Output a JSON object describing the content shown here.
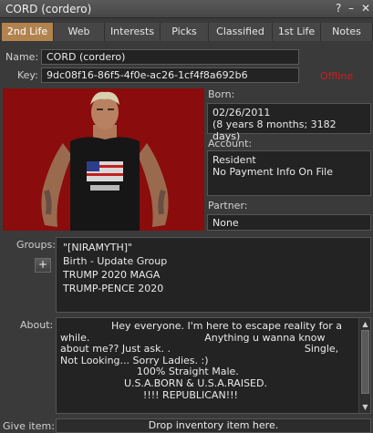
{
  "window": {
    "title": "CORD (cordero)",
    "help_glyph": "?",
    "minimize_glyph": "–",
    "close_glyph": "✕"
  },
  "tabs": [
    {
      "label": "2nd Life",
      "active": true
    },
    {
      "label": "Web"
    },
    {
      "label": "Interests"
    },
    {
      "label": "Picks"
    },
    {
      "label": "Classified"
    },
    {
      "label": "1st Life"
    },
    {
      "label": "Notes"
    }
  ],
  "profile": {
    "name_label": "Name:",
    "name_value": "CORD (cordero)",
    "key_label": "Key:",
    "key_value": "9dc08f16-86f5-4f0e-ac26-1cf4f8a692b6",
    "status": "Offline",
    "born_label": "Born:",
    "born_date": "02/26/2011",
    "born_age": "(8 years 8 months; 3182 days)",
    "account_label": "Account:",
    "account_type": "Resident",
    "account_payment": "No Payment Info On File",
    "partner_label": "Partner:",
    "partner_value": "None",
    "groups_label": "Groups:",
    "groups": [
      "\"[NIRAMYTH]\"",
      "Birth - Update Group",
      "TRUMP 2020 MAGA",
      "TRUMP-PENCE 2020"
    ],
    "add_group_glyph": "+",
    "about_label": "About:",
    "about_text": "                Hey everyone. I'm here to escape reality for a while.                                    Anything u wanna know about me?? Just ask. .                                          Single, Not Looking... Sorry Ladies. :)\n                        100% Straight Male.\n                    U.S.A.BORN & U.S.A.RAISED.\n                          !!!! REPUBLICAN!!!",
    "give_item_label": "Give item:",
    "drop_hint": "Drop inventory item here."
  },
  "colors": {
    "active_tab": "#b2834f",
    "offline": "#d61a1a",
    "photo_bg": "#8a0c0c"
  }
}
